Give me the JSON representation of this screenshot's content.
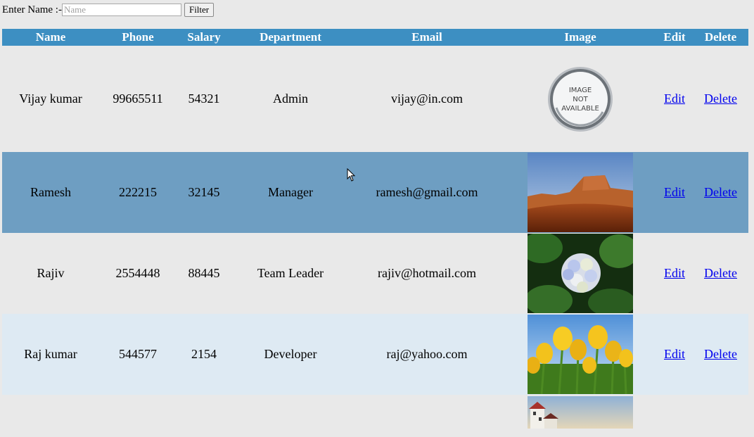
{
  "filter": {
    "label": "Enter Name :-",
    "placeholder": "Name",
    "button_label": "Filter"
  },
  "table": {
    "headers": [
      "Name",
      "Phone",
      "Salary",
      "Department",
      "Email",
      "Image",
      "Edit",
      "Delete"
    ],
    "rows": [
      {
        "name": "Vijay kumar",
        "phone": "99665511",
        "salary": "54321",
        "department": "Admin",
        "email": "vijay@in.com",
        "image": "image-not-available",
        "image_text": [
          "IMAGE",
          "NOT",
          "AVAILABLE"
        ],
        "edit": "Edit",
        "delete": "Delete"
      },
      {
        "name": "Ramesh",
        "phone": "222215",
        "salary": "32145",
        "department": "Manager",
        "email": "ramesh@gmail.com",
        "image": "desert-photo",
        "edit": "Edit",
        "delete": "Delete"
      },
      {
        "name": "Rajiv",
        "phone": "2554448",
        "salary": "88445",
        "department": "Team Leader",
        "email": "rajiv@hotmail.com",
        "image": "hydrangea-photo",
        "edit": "Edit",
        "delete": "Delete"
      },
      {
        "name": "Raj kumar",
        "phone": "544577",
        "salary": "2154",
        "department": "Developer",
        "email": "raj@yahoo.com",
        "image": "tulips-photo",
        "edit": "Edit",
        "delete": "Delete"
      },
      {
        "name": "",
        "phone": "",
        "salary": "",
        "department": "",
        "email": "",
        "image": "lighthouse-photo",
        "edit": "",
        "delete": ""
      }
    ]
  },
  "colors": {
    "header_bg": "#3d8fc2",
    "selected_row_bg": "#6e9ec2",
    "alt_row_bg": "#deeaf3",
    "page_bg": "#e9e9e9",
    "link": "#0000ee"
  }
}
